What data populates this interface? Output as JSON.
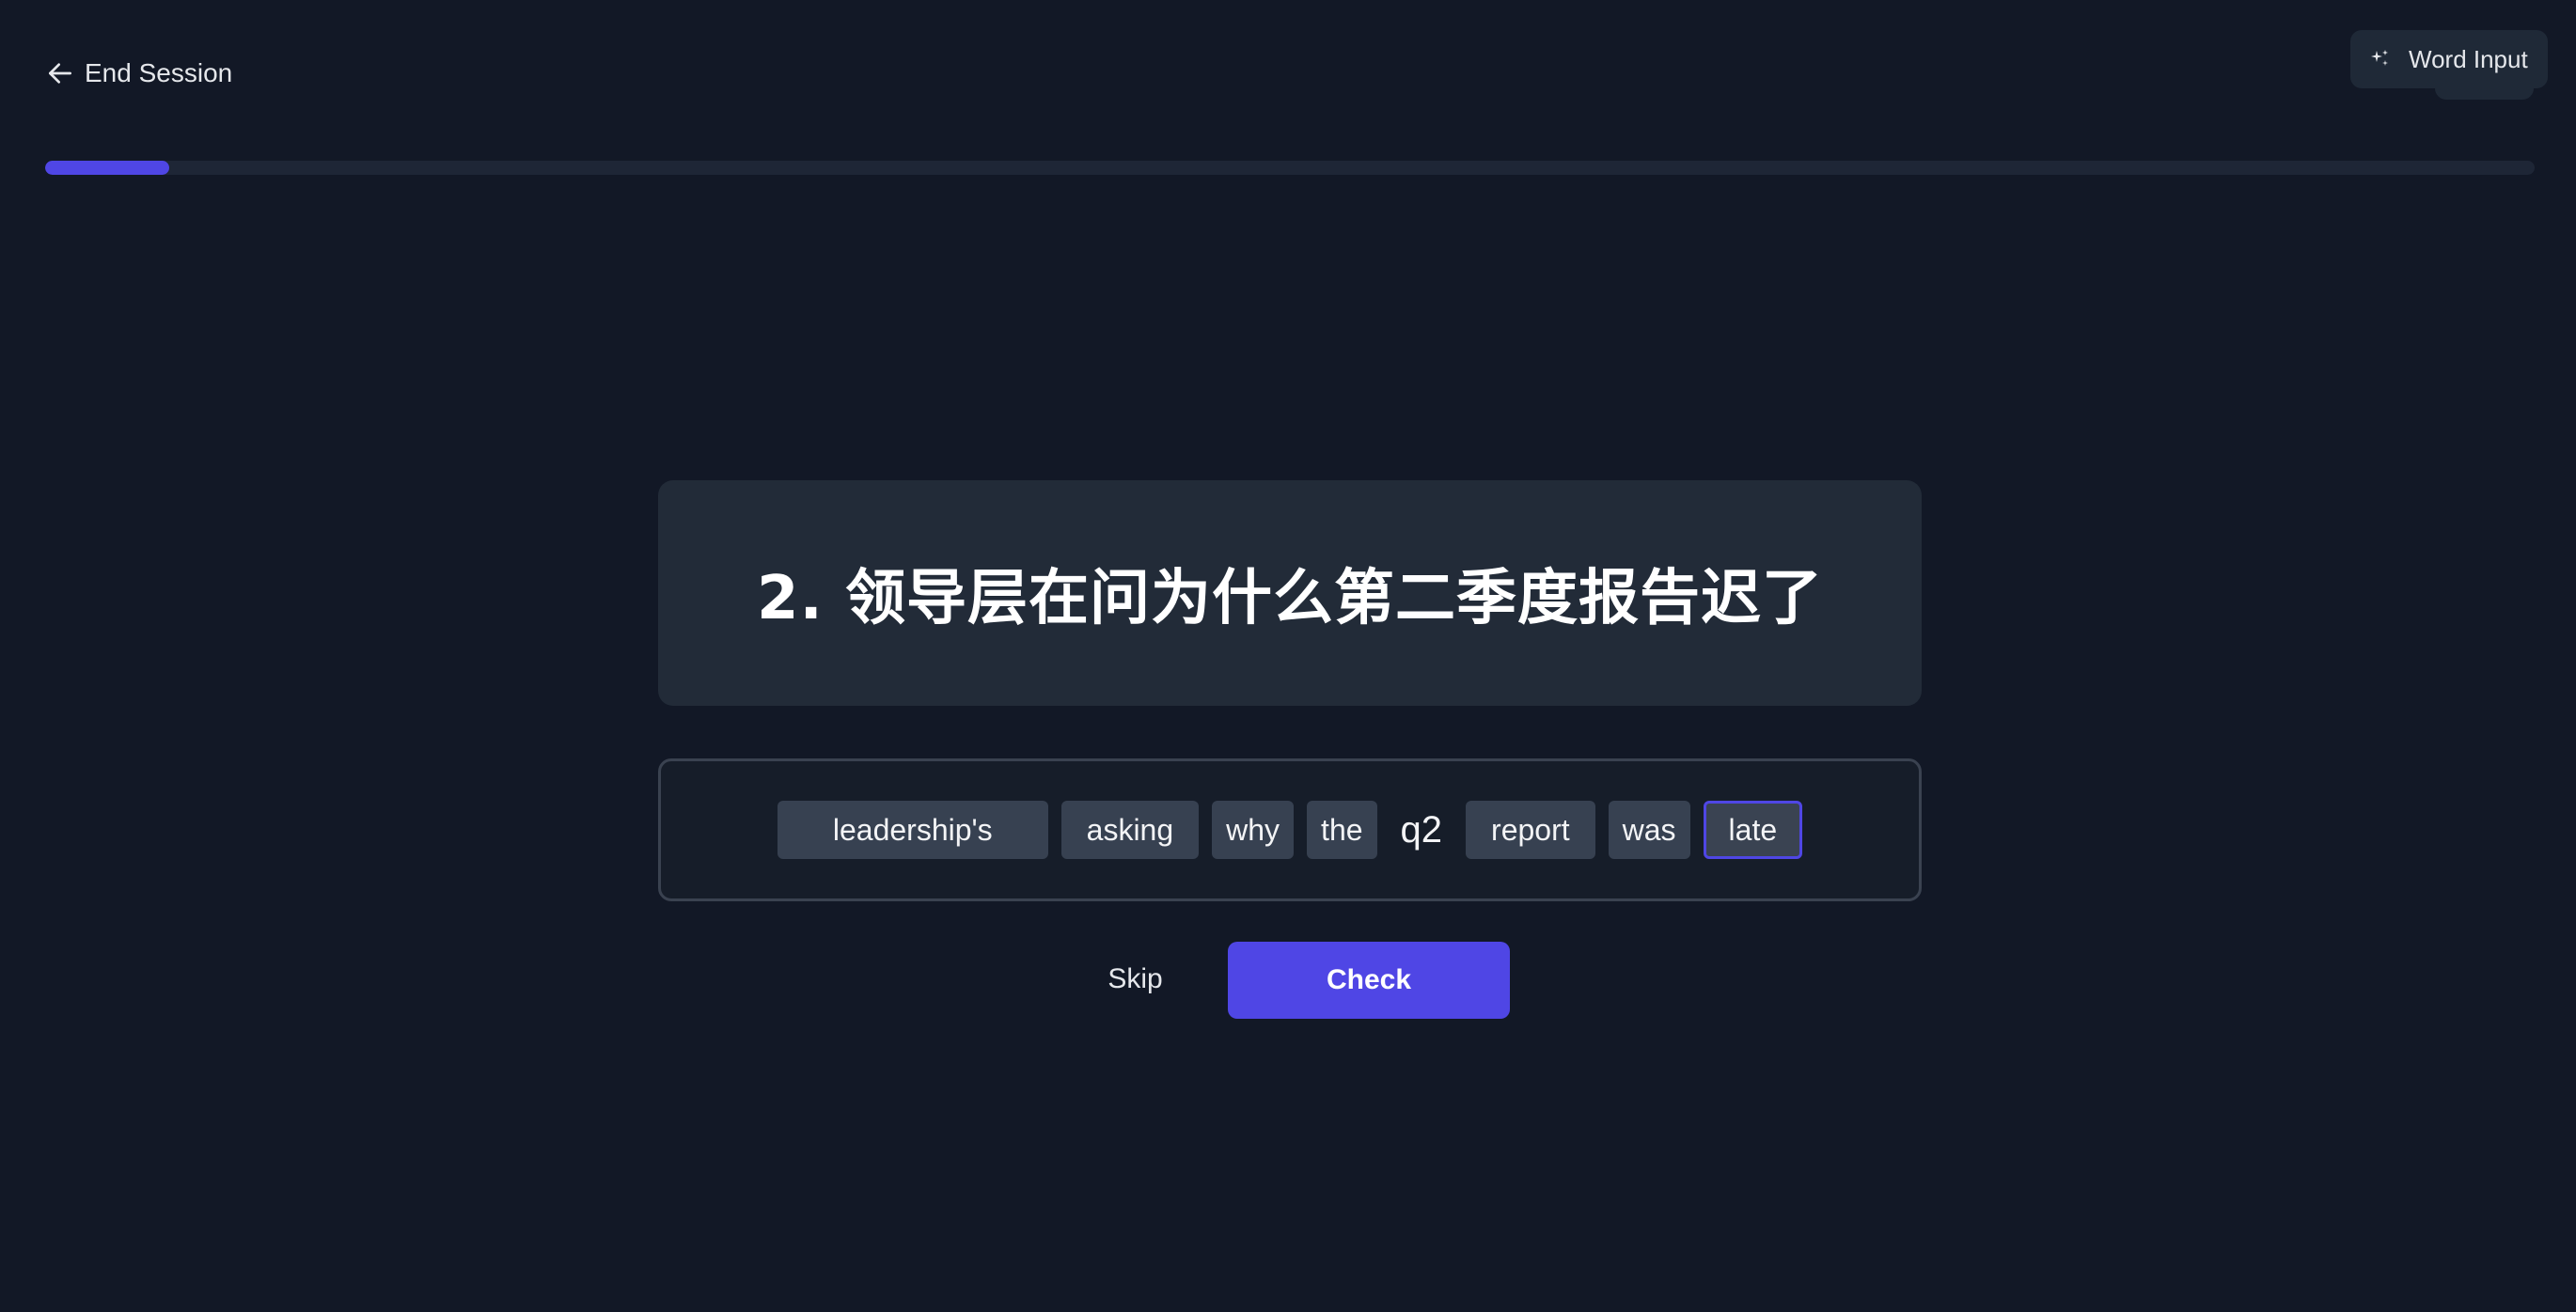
{
  "header": {
    "end_session_label": "End Session",
    "end_session_icon": "arrow-left-icon",
    "mode_label": "Word Input",
    "mode_icon": "sparkle-icon"
  },
  "progress": {
    "fraction": 0.05,
    "accent_color": "#4f46e5"
  },
  "prompt": {
    "text": "2. 领导层在问为什么第二季度报告迟了"
  },
  "answer": {
    "words": [
      "leadership's",
      "asking",
      "why",
      "the",
      "q2",
      "report",
      "was",
      "late"
    ],
    "active_word_index": 7
  },
  "actions": {
    "skip_label": "Skip",
    "check_label": "Check"
  },
  "colors": {
    "background": "#121826",
    "card": "#222b38",
    "chip": "#374151",
    "primary": "#4f46e5"
  }
}
